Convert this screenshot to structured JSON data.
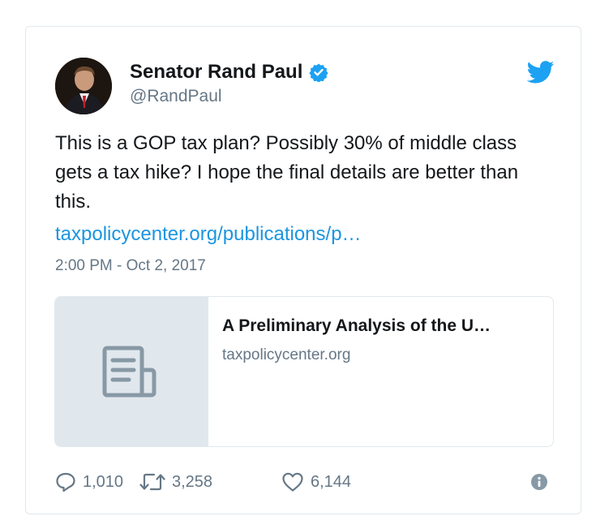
{
  "tweet": {
    "author_name": "Senator Rand Paul",
    "handle": "@RandPaul",
    "text": "This is a GOP tax plan? Possibly 30% of middle class gets a tax hike? I hope the final details are better than this.",
    "link": "taxpolicycenter.org/publications/p…",
    "timestamp": "2:00 PM - Oct 2, 2017"
  },
  "link_card": {
    "title": "A Preliminary Analysis of the U…",
    "domain": "taxpolicycenter.org",
    "icon": "document-icon"
  },
  "actions": {
    "replies": "1,010",
    "retweets": "3,258",
    "likes": "6,144"
  },
  "icons": {
    "bird": "twitter-bird-icon",
    "verified": "verified-badge-icon",
    "reply": "reply-icon",
    "retweet": "retweet-icon",
    "like": "heart-icon",
    "info": "info-icon"
  },
  "colors": {
    "brand": "#1da1f2",
    "link": "#1b95e0",
    "muted": "#657786",
    "text": "#14171a",
    "border": "#e1e8ed"
  }
}
